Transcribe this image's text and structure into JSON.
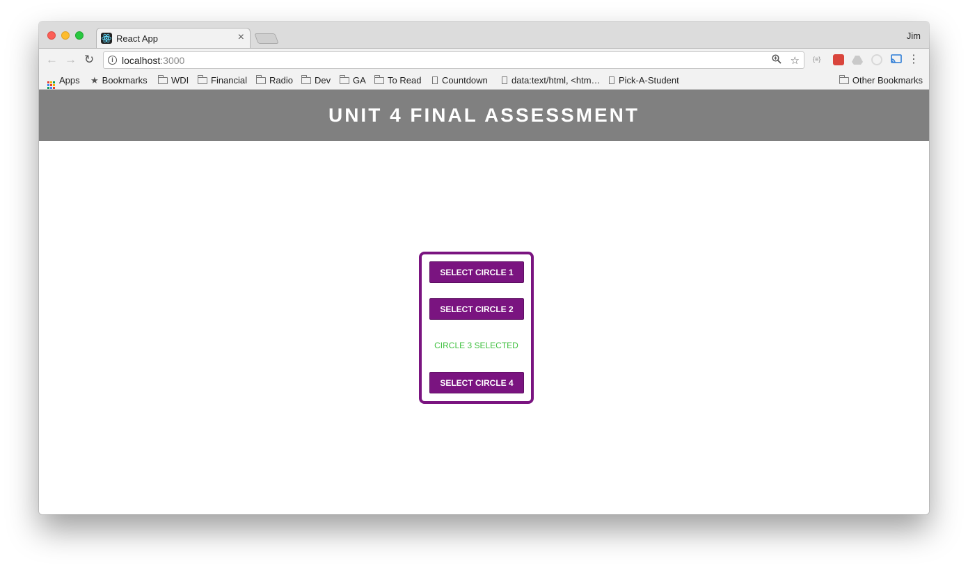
{
  "browser": {
    "tab_title": "React App",
    "tab_close": "×",
    "profile": "Jim",
    "url_host": "localhost",
    "url_port": ":3000",
    "ext_glyph": "{≡}"
  },
  "bookmarks": {
    "left": [
      "Apps",
      "Bookmarks",
      "WDI",
      "Financial",
      "Radio",
      "Dev",
      "GA",
      "To Read",
      "Countdown",
      "data:text/html, <htm…",
      "Pick-A-Student"
    ],
    "right": "Other Bookmarks"
  },
  "page": {
    "title": "UNIT 4 FINAL ASSESSMENT",
    "circles": [
      {
        "label": "Select Circle 1",
        "selected": false
      },
      {
        "label": "Select Circle 2",
        "selected": false
      },
      {
        "label": "CIRCLE 3 SELECTED",
        "selected": true
      },
      {
        "label": "Select Circle 4",
        "selected": false
      }
    ]
  },
  "colors": {
    "header_bg": "#808080",
    "accent_purple": "#7a1480",
    "selected_green": "#40c040"
  }
}
